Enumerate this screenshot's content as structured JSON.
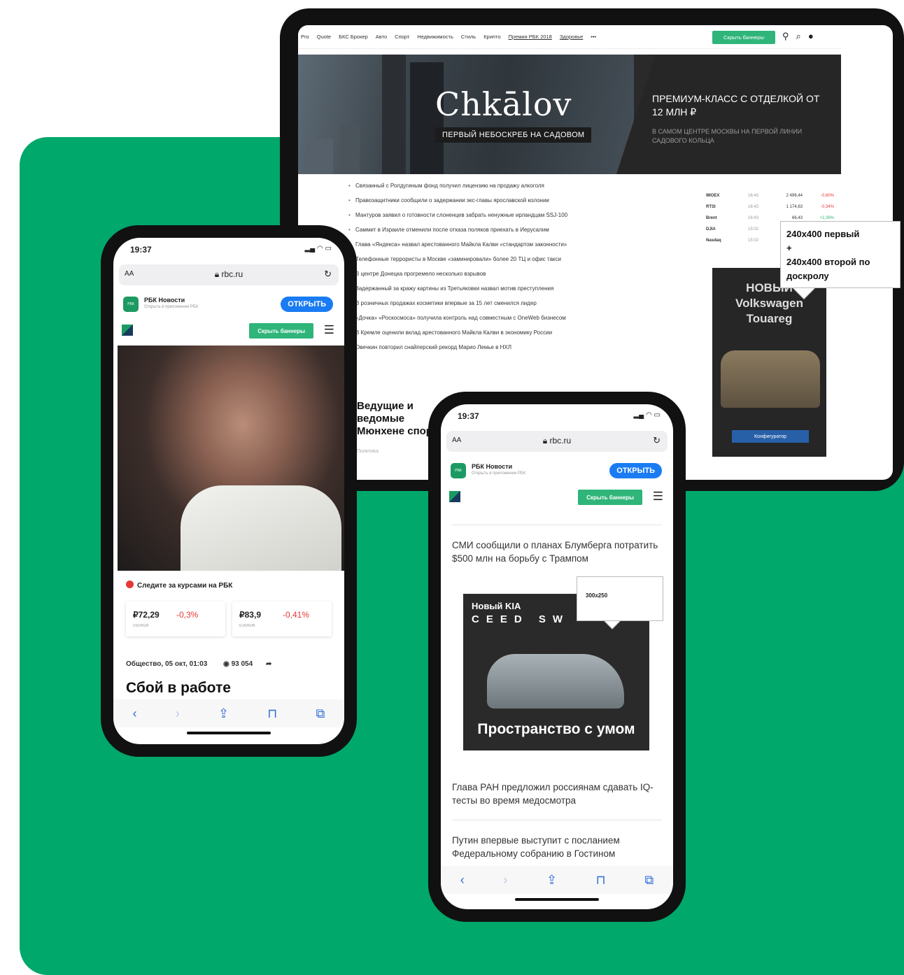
{
  "tablet": {
    "nav": [
      "Pro",
      "Quote",
      "БКС Брокер",
      "Авто",
      "Спорт",
      "Недвижимость",
      "Стиль",
      "Крипто",
      "Премия РБК 2018",
      "Здоровье",
      "•••"
    ],
    "hide_banners": "Скрыть баннеры",
    "hero": {
      "brand": "Chkālov",
      "subtitle": "ПЕРВЫЙ НЕБОСКРЕБ НА САДОВОМ",
      "right_title": "ПРЕМИУМ-КЛАСС С ОТДЕЛКОЙ ОТ 12 МЛН ₽",
      "right_sub": "В САМОМ ЦЕНТРЕ МОСКВЫ НА ПЕРВОЙ ЛИНИИ САДОВОГО КОЛЬЦА"
    },
    "news": [
      "Связанный с Ролдугиным фонд получил лицензию на продажу алкоголя",
      "Правозащитники сообщили о задержании экс-главы ярославской колонии",
      "Мантуров заявил о готовности слоненцев забрать ненужные ирландцам SSJ-100",
      "Саммит в Израиле отменили после отказа поляков приехать в Иерусалим",
      "Глава «Яндекса» назвал арестованного Майкла Калви «стандартом законности»",
      "Телефонные террористы в Москве «заминировали» более 20 ТЦ и офис такси",
      "В центре Донецка прогремело несколько взрывов",
      "Задержанный за кражу картины из Третьяковки назвал мотив преступления",
      "В розничных продажах косметики впервые за 15 лет сменился лидер",
      "«Дочка» «Роскосмоса» получила контроль над совместным с OneWeb бизнесом",
      "В Кремле оценили вклад арестованного Майкла Калви в экономику России",
      "Овечкин повторил снайперский рекорд Марио Лемье в НХЛ"
    ],
    "headline": "Ведущие и ведомые Мюнхене спорт РГ",
    "headline_tag": "Политика",
    "quotes": [
      {
        "name": "IMOEX",
        "time": "16:43",
        "value": "2 496,44",
        "change": "-0,60%",
        "dir": "neg"
      },
      {
        "name": "RTSI",
        "time": "16:43",
        "value": "1 174,63",
        "change": "-0,34%",
        "dir": "neg"
      },
      {
        "name": "Brent",
        "time": "16:43",
        "value": "66,43",
        "change": "+1,36%",
        "dir": "pos"
      },
      {
        "name": "DJIA",
        "time": "15:02",
        "value": "25 8…",
        "change": "",
        "dir": "pos"
      },
      {
        "name": "Nasdaq",
        "time": "15:02",
        "value": "7…",
        "change": "",
        "dir": "pos"
      }
    ],
    "vw": {
      "title": "НОВЫЙ Volkswagen Touareg",
      "button": "Конфигуратор"
    },
    "callout": {
      "line1": "240x400 первый",
      "plus": "+",
      "line2": "240x400 второй по доскролу"
    }
  },
  "phoneA": {
    "time": "19:37",
    "aa": "AA",
    "url": "rbc.ru",
    "app_name": "РБК Новости",
    "app_sub": "Открыть в приложении РБК",
    "app_logo": "РБК",
    "open": "ОТКРЫТЬ",
    "hide_banners": "Скрыть баннеры",
    "follow": "Следите за курсами на РБК",
    "rates": [
      {
        "value": "₽72,29",
        "change": "-0,3%",
        "pair": "USD/RUB"
      },
      {
        "value": "₽83,9",
        "change": "-0,41%",
        "pair": "EUR/RUB"
      }
    ],
    "meta": "Общество, 05 окт, 01:03",
    "views": "93 054",
    "headline": "Сбой в работе"
  },
  "phoneB": {
    "time": "19:37",
    "aa": "AA",
    "url": "rbc.ru",
    "app_name": "РБК Новости",
    "app_sub": "Открыть в приложении РБК",
    "app_logo": "РБК",
    "open": "ОТКРЫТЬ",
    "hide_banners": "Скрыть баннеры",
    "news1": "СМИ сообщили о планах Блумберга потратить $500 млн на борьбу с Трампом",
    "news2": "Глава РАН предложил россиянам сдавать IQ-тесты во время медосмотра",
    "news3": "Путин впервые выступит с посланием Федеральному собранию в Гостином",
    "kia": {
      "line1": "Новый KIA",
      "line2": "CEED SW",
      "slogan": "Пространство с умом"
    },
    "callout": "300x250"
  },
  "icons": [
    "location-icon",
    "search-icon",
    "user-icon",
    "back-icon",
    "forward-icon",
    "share-icon",
    "bookmarks-icon",
    "tabs-icon",
    "reload-icon",
    "lock-icon",
    "eye-icon",
    "share-arrow-icon",
    "menu-icon"
  ],
  "colors": {
    "green": "#00a86b",
    "button_green": "#2fb57a",
    "open_blue": "#1a7cf2",
    "negative": "#e53935"
  }
}
